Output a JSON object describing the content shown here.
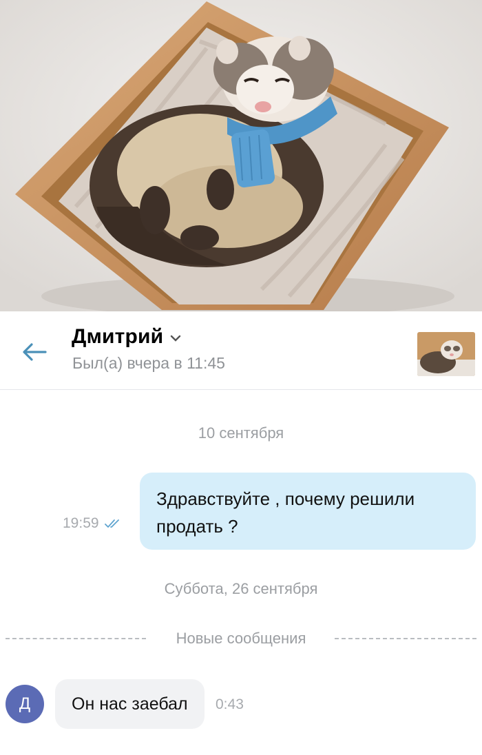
{
  "photo": {
    "description_icon": "ferret-photo"
  },
  "header": {
    "contact_name": "Дмитрий",
    "last_seen": "Был(а) вчера в 11:45",
    "back_icon": "arrow-left-icon",
    "accent_color": "#4a90b8"
  },
  "chat": {
    "date_1": "10 сентября",
    "outgoing": {
      "text": "Здравствуйте , почему решили продать ?",
      "time": "19:59",
      "status_icon": "double-check-icon"
    },
    "date_2": "Суббота, 26 сентября",
    "new_messages_label": "Новые сообщения",
    "incoming": {
      "avatar_letter": "Д",
      "avatar_color": "#5b6bb5",
      "text": "Он нас заебал",
      "time": "0:43"
    }
  }
}
